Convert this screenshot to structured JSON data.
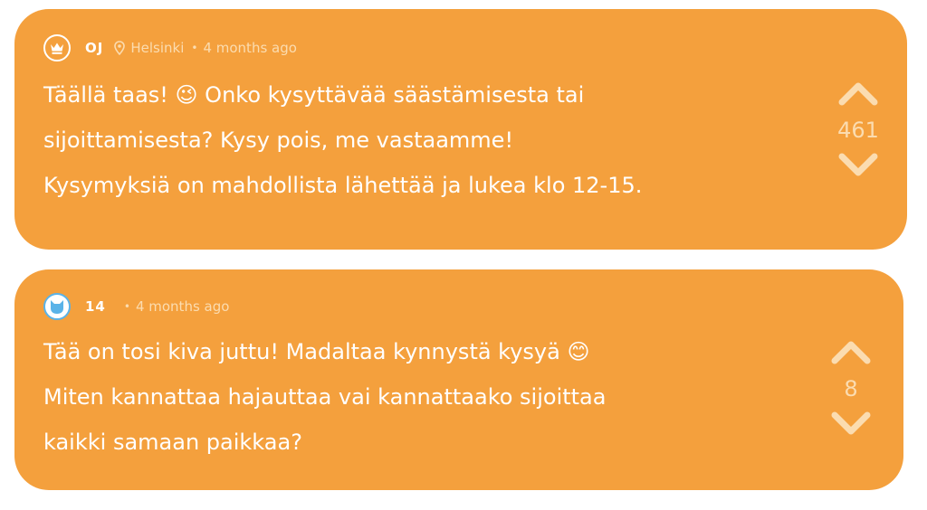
{
  "posts": [
    {
      "author": "OJ",
      "location": "Helsinki",
      "time": "4 months ago",
      "avatar_icon": "crown-icon",
      "lines": [
        "Täällä taas! 😉  Onko kysyttävää säästämisesta tai",
        "sijoittamisesta? Kysy pois, me vastaamme!",
        "Kysymyksiä on mahdollista lähettää ja lukea klo 12-15."
      ],
      "votes": "461"
    },
    {
      "author": "14",
      "time": "4 months ago",
      "avatar_icon": "cat-icon",
      "lines": [
        "Tää on tosi kiva juttu! Madaltaa kynnystä kysyä 😊",
        "Miten kannattaa hajauttaa vai kannattaako sijoittaa",
        "kaikki samaan paikkaa?"
      ],
      "votes": "8"
    }
  ],
  "colors": {
    "card": "#f4a03d",
    "text": "#ffffff",
    "muted": "#fbdcb0",
    "avatar_ring": "#5ab3e8"
  }
}
